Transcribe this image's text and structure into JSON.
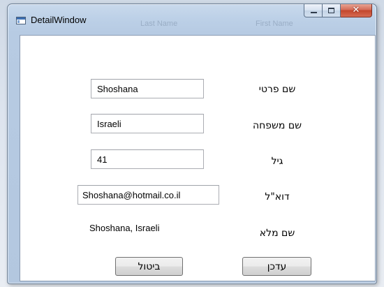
{
  "window": {
    "title": "DetailWindow",
    "background_header_hints": [
      "Last Name",
      "First Name"
    ]
  },
  "form": {
    "first_name": {
      "label": "שם פרטי",
      "value": "Shoshana"
    },
    "last_name": {
      "label": "שם משפחה",
      "value": "Israeli"
    },
    "age": {
      "label": "גיל",
      "value": "41"
    },
    "email": {
      "label": "דוא\"ל",
      "value": "Shoshana@hotmail.co.il"
    },
    "full_name": {
      "label": "שם מלא",
      "value": "Shoshana, Israeli"
    }
  },
  "buttons": {
    "cancel_label": "ביטול",
    "update_label": "עדכן"
  },
  "colors": {
    "close_button": "#c2452c",
    "window_frame": "#b7cbe3"
  }
}
